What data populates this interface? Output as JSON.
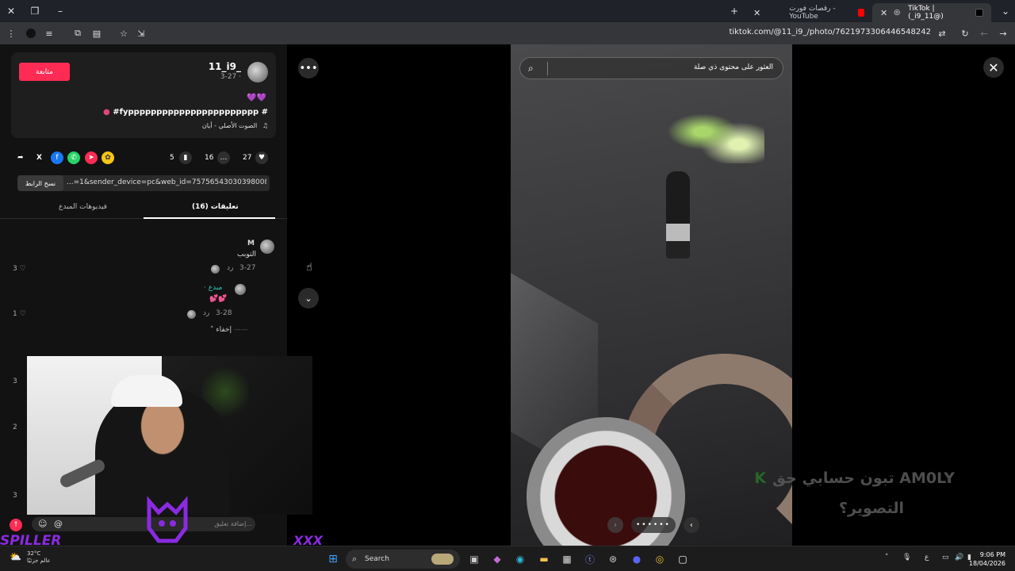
{
  "browser": {
    "tabs": [
      {
        "title": "TikTok | (_i9_11@)",
        "active": true
      },
      {
        "title": "رقصات فورت - YouTube",
        "active": false
      }
    ],
    "url": "tiktok.com/@11_i9_/photo/7621973306446548242"
  },
  "post": {
    "follow_label": "متابعة",
    "username": "11_i9_",
    "date": "3-27 ·",
    "caption_emoji": "💜💜",
    "caption": "#fyppppppppppppppppppppppp #",
    "sound": "الصوت الأصلي - أيان",
    "likes": "27",
    "comments": "16",
    "saves": "5",
    "copy_link_label": "نسخ الرابط",
    "link": "...=1&sender_device=pc&web_id=7575654303039800850"
  },
  "tabs": {
    "comments_label": "(16) تعليقات",
    "creator_videos_label": "فيديوهات المبدع"
  },
  "comments": [
    {
      "name": "M",
      "text": "التوبب",
      "date": "3-27",
      "reply": "رد",
      "likes": "3"
    },
    {
      "name": "· مبدع",
      "text": "💕💕",
      "date": "3-28",
      "reply": "رد",
      "likes": "1"
    }
  ],
  "hide_label": "إخفاء",
  "comment_placeholder": "إضافة تعليق...",
  "streamer": {
    "left": "SPILLER",
    "right": "XXX"
  },
  "photo": {
    "search_text": "العثور على محتوى ذي صلة",
    "dots": "••••••"
  },
  "overlay": {
    "line1": "تبون حسابي حق  AM0LY",
    "line2": "التصوير؟"
  },
  "taskbar": {
    "weather_temp": "32°C",
    "weather_desc": "عالم جزئيًا",
    "search_label": "Search",
    "time": "9:06 PM",
    "date": "18/04/2026",
    "lang": "ع"
  },
  "colors": {
    "follow": "#fe2c55",
    "accent_purple": "#8a2be2"
  }
}
